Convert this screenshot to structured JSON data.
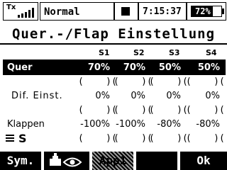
{
  "status": {
    "tx_label": "Tx",
    "model_name": "Normal",
    "time": "7:15:37",
    "battery_percent": "72%",
    "battery_level": 0.72
  },
  "title": "Quer.-/Flap Einstellung",
  "columns": [
    "S1",
    "S2",
    "S3",
    "S4"
  ],
  "rows": [
    {
      "label": "Quer",
      "values": [
        "70%",
        "70%",
        "50%",
        "50%"
      ],
      "selected": true
    },
    {
      "label": "Dif. Einst.",
      "values": [
        "0%",
        "0%",
        "0%",
        "0%"
      ],
      "selected": false
    },
    {
      "label": "Klappen",
      "values": [
        "-100%",
        "-100%",
        "-80%",
        "-80%"
      ],
      "selected": false
    }
  ],
  "paren_segment": "(    )(",
  "bottom_label": "S",
  "softkeys": {
    "sym": "Sym.",
    "app": "App1",
    "ok": "Ok"
  },
  "icons": {
    "signal": "signal-bars-icon",
    "flight_mode": "square-icon",
    "monitor": "servo-eye-icon",
    "switch": "switch-lines-icon"
  }
}
